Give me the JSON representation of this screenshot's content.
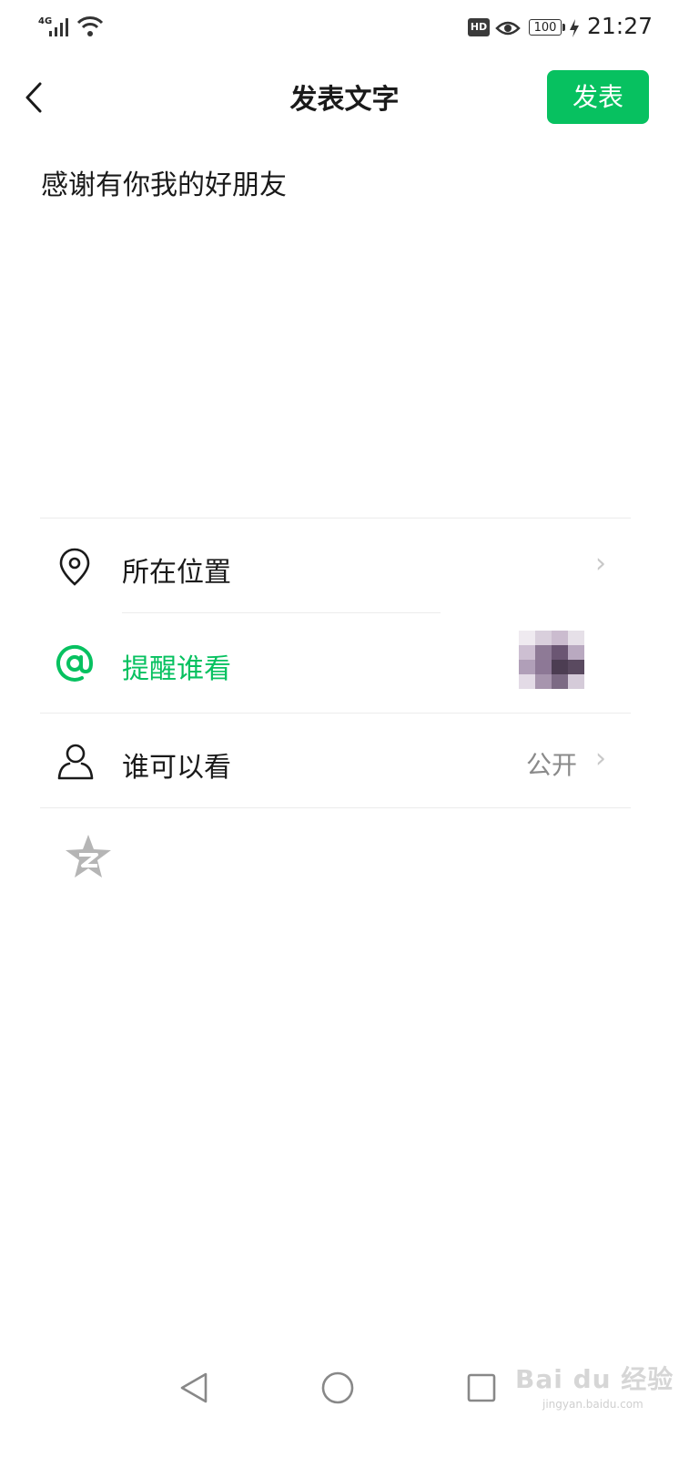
{
  "status_bar": {
    "network": "4G",
    "hd": "HD",
    "battery": "100",
    "time": "21:27"
  },
  "header": {
    "title": "发表文字",
    "publish_label": "发表"
  },
  "post": {
    "text": "感谢有你我的好朋友"
  },
  "options": {
    "location": {
      "label": "所在位置",
      "icon": "location-pin-icon"
    },
    "mention": {
      "label": "提醒谁看",
      "icon": "at-icon"
    },
    "visibility": {
      "label": "谁可以看",
      "value": "公开",
      "icon": "person-icon"
    }
  },
  "share_icon": "qzone-star-icon",
  "watermark": {
    "main": "Bai du 经验",
    "sub": "jingyan.baidu.com"
  },
  "colors": {
    "accent": "#07c160",
    "text": "#1a1a1a",
    "muted": "#8a8a8a"
  }
}
